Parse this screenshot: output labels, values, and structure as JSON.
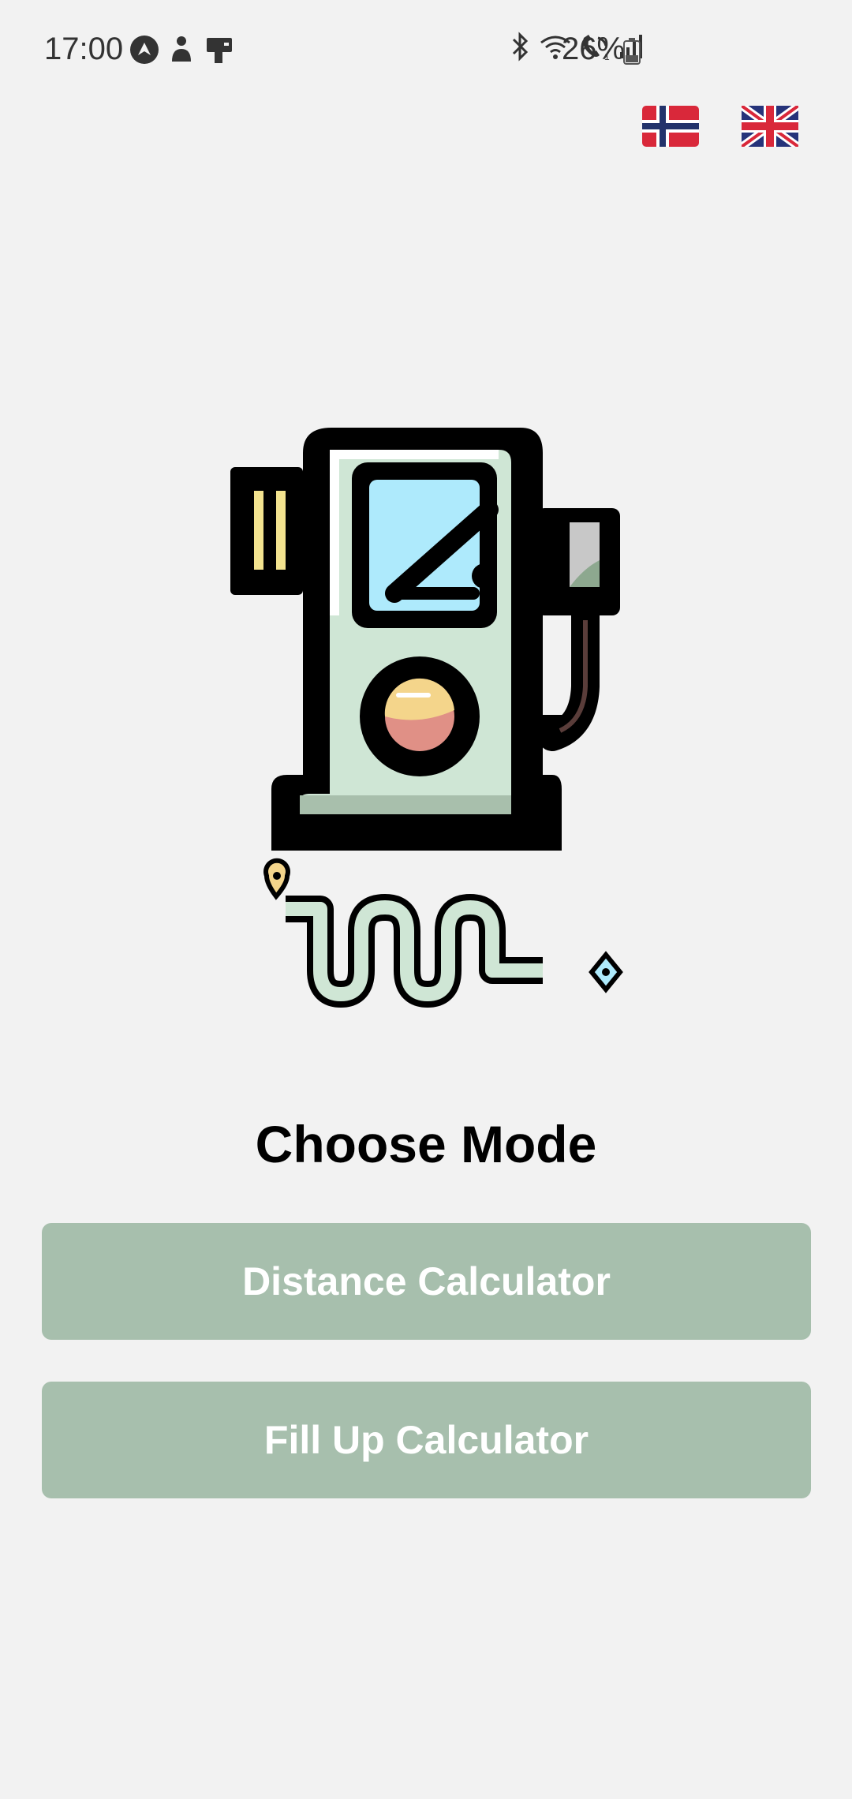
{
  "status_bar": {
    "time": "17:00",
    "battery_percent": "26%",
    "left_icons": [
      "navigation-app-icon",
      "person-notification-icon",
      "device-notification-icon"
    ],
    "right_icons": [
      "bluetooth-icon",
      "wifi-icon",
      "wifi-calling-icon",
      "signal-icon",
      "battery-icon"
    ]
  },
  "language": {
    "options": [
      {
        "code": "no",
        "icon": "norway-flag-icon"
      },
      {
        "code": "en",
        "icon": "uk-flag-icon"
      }
    ]
  },
  "hero": {
    "icon": "ev-charging-station-illustration"
  },
  "main": {
    "title": "Choose Mode",
    "buttons": [
      {
        "label": "Distance Calculator"
      },
      {
        "label": "Fill Up Calculator"
      }
    ]
  },
  "colors": {
    "background": "#f2f2f2",
    "button": "#a7bfad",
    "button_text": "#ffffff",
    "title_text": "#000000"
  }
}
